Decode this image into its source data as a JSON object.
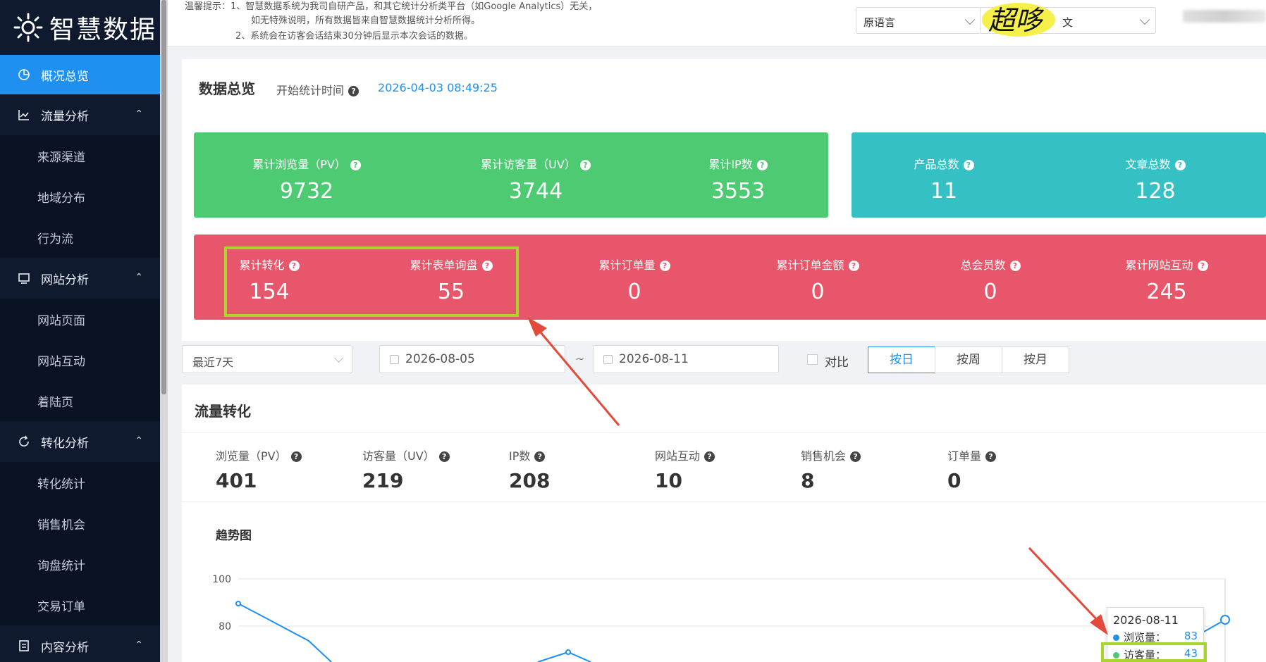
{
  "app": {
    "logo_text": "智慧数据"
  },
  "sidebar": {
    "active_item": {
      "label": "概况总览",
      "icon": "pie-chart-icon"
    },
    "groups": [
      {
        "label": "流量分析",
        "icon": "line-chart-icon",
        "items": [
          "来源渠道",
          "地域分布",
          "行为流"
        ]
      },
      {
        "label": "网站分析",
        "icon": "monitor-icon",
        "items": [
          "网站页面",
          "网站互动",
          "着陆页"
        ]
      },
      {
        "label": "转化分析",
        "icon": "refresh-icon",
        "items": [
          "转化统计",
          "销售机会",
          "询盘统计",
          "交易订单"
        ]
      },
      {
        "label": "内容分析",
        "icon": "document-icon",
        "items": []
      }
    ]
  },
  "notice": {
    "line1": "温馨提示：1、智慧数据系统为我司自研产品，和其它统计分析类平台（如Google Analytics）无关，",
    "line2": "如无特殊说明，所有数据皆来自智慧数据统计分析所得。",
    "line3": "2、系统会在访客会话结束30分钟后显示本次会话的数据。"
  },
  "header": {
    "lang_select": "原语言",
    "target_lang_select": "文",
    "scribble": "超哆"
  },
  "overview": {
    "title": "数据总览",
    "start_label": "开始统计时间",
    "start_value": "2026-04-03 08:49:25",
    "green": [
      {
        "label": "累计浏览量（PV）",
        "value": "9732"
      },
      {
        "label": "累计访客量（UV）",
        "value": "3744"
      },
      {
        "label": "累计IP数",
        "value": "3553"
      }
    ],
    "teal": [
      {
        "label": "产品总数",
        "value": "11"
      },
      {
        "label": "文章总数",
        "value": "128"
      }
    ],
    "red": [
      {
        "label": "累计转化",
        "value": "154"
      },
      {
        "label": "累计表单询盘",
        "value": "55"
      },
      {
        "label": "累计订单量",
        "value": "0"
      },
      {
        "label": "累计订单金额",
        "value": "0"
      },
      {
        "label": "总会员数",
        "value": "0"
      },
      {
        "label": "累计网站互动",
        "value": "245"
      }
    ]
  },
  "filters": {
    "range": "最近7天",
    "start_date": "2026-08-05",
    "separator": "~",
    "end_date": "2026-08-11",
    "compare_label": "对比",
    "granularity": [
      "按日",
      "按周",
      "按月"
    ],
    "granularity_active": 0
  },
  "flow": {
    "title": "流量转化",
    "kpis": [
      {
        "label": "浏览量（PV）",
        "value": "401"
      },
      {
        "label": "访客量（UV）",
        "value": "219"
      },
      {
        "label": "IP数",
        "value": "208"
      },
      {
        "label": "网站互动",
        "value": "10"
      },
      {
        "label": "销售机会",
        "value": "8"
      },
      {
        "label": "订单量",
        "value": "0"
      }
    ],
    "trend_title": "趋势图"
  },
  "chart_data": {
    "type": "line",
    "yticks": [
      "100",
      "80"
    ],
    "series": [
      {
        "name": "浏览量",
        "color": "#1f8ff0"
      }
    ]
  },
  "tooltip": {
    "date": "2026-08-11",
    "row1_label": "浏览量：",
    "row1_value": "83",
    "row2_label": "访客量：",
    "row2_value": "43"
  },
  "colors": {
    "accent": "#1f8ff0",
    "green": "#4ecb72",
    "teal": "#35c1c4",
    "red": "#e8566b",
    "highlight": "#a9d42c"
  }
}
